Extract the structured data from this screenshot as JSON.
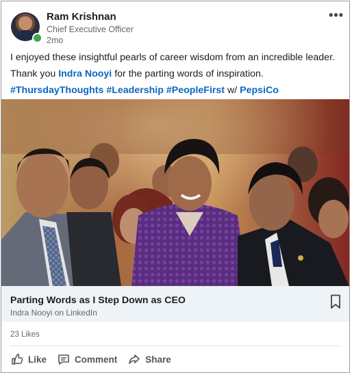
{
  "post": {
    "author": {
      "name": "Ram Krishnan",
      "title": "Chief Executive Officer",
      "time": "2mo",
      "online": true
    },
    "text": {
      "line1": "I enjoyed these insightful pearls of career wisdom from an incredible leader.",
      "line2_prefix": "Thank you ",
      "mention": "Indra Nooyi",
      "line2_suffix": " for the parting words of inspiration.",
      "hashtag1": "#ThursdayThoughts",
      "hashtag2": "#Leadership",
      "hashtag3": "#PeopleFirst",
      "with_text": "w/",
      "company_mention": "PepsiCo"
    },
    "article": {
      "title": "Parting Words as I Step Down as CEO",
      "source": "Indra Nooyi on LinkedIn"
    },
    "likes": "23 Likes",
    "actions": {
      "like": "Like",
      "comment": "Comment",
      "share": "Share"
    }
  },
  "icons": {
    "more": "more-horizontal-icon",
    "bookmark": "bookmark-icon",
    "like": "thumbs-up-icon",
    "comment": "comment-icon",
    "share": "share-arrow-icon"
  },
  "colors": {
    "link": "#0a66c2",
    "presence": "#3ea84a",
    "preview_bg": "#eef3f8",
    "muted_text": "#666666"
  }
}
